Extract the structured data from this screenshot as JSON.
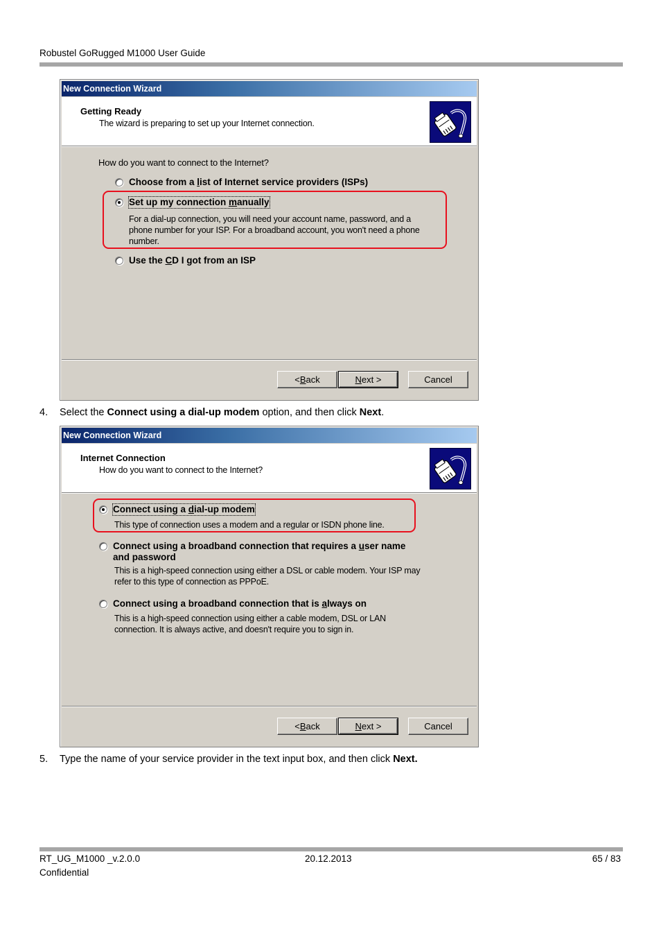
{
  "document": {
    "header_title": "Robustel GoRugged M1000 User Guide",
    "footer": {
      "doc_id": "RT_UG_M1000 _v.2.0.0",
      "confidentiality": "Confidential",
      "date": "20.12.2013",
      "page": "65 / 83"
    },
    "steps": [
      {
        "number": "4.",
        "parts": [
          "Select the ",
          "Connect using a dial-up modem",
          " option, and then click ",
          "Next",
          "."
        ]
      },
      {
        "number": "5.",
        "parts": [
          "Type the name of your service provider in the text input box, and then click ",
          "Next."
        ]
      }
    ]
  },
  "wizard1": {
    "title": "New Connection Wizard",
    "heading": "Getting Ready",
    "subheading": "The wizard is preparing to set up your Internet connection.",
    "icon": "network-cable-icon",
    "question": "How do you want to connect to the Internet?",
    "options": [
      {
        "label_pre": "Choose from a ",
        "label_u": "l",
        "label_post": "ist of Internet service providers (ISPs)",
        "checked": false,
        "description": ""
      },
      {
        "label_pre": "Set up my connection ",
        "label_u": "m",
        "label_post": "anually",
        "checked": true,
        "description_lines": [
          "For a dial-up connection, you will need your account name, password, and a",
          "phone number for your ISP. For a broadband account, you won't need a phone",
          "number."
        ]
      },
      {
        "label_pre": "Use the ",
        "label_u": "C",
        "label_post": "D I got from an ISP",
        "checked": false,
        "description": ""
      }
    ],
    "buttons": {
      "back_pre": "< ",
      "back_u": "B",
      "back_post": "ack",
      "next_u": "N",
      "next_post": "ext >",
      "cancel": "Cancel"
    },
    "highlight_color": "#e8101e"
  },
  "wizard2": {
    "title": "New Connection Wizard",
    "heading": "Internet Connection",
    "subheading": "How do you want to connect to the Internet?",
    "icon": "network-cable-icon",
    "options": [
      {
        "label_pre": "Connect using a ",
        "label_u": "d",
        "label_post": "ial-up modem",
        "checked": true,
        "description_lines": [
          "This type of connection uses a modem and a regular or ISDN phone line."
        ]
      },
      {
        "label_pre": "Connect using a broadband connection that requires a ",
        "label_u": "u",
        "label_post": "ser name",
        "label_line2": "and password",
        "checked": false,
        "description_lines": [
          "This is a high-speed connection using either a DSL or cable modem. Your ISP may",
          "refer to this type of connection as PPPoE."
        ]
      },
      {
        "label_pre": "Connect using a broadband connection that is ",
        "label_u": "a",
        "label_post": "lways on",
        "checked": false,
        "description_lines": [
          "This is a high-speed connection using either a cable modem, DSL or LAN",
          "connection. It is always active, and doesn't require you to sign in."
        ]
      }
    ],
    "buttons": {
      "back_pre": "< ",
      "back_u": "B",
      "back_post": "ack",
      "next_u": "N",
      "next_post": "ext >",
      "cancel": "Cancel"
    }
  }
}
